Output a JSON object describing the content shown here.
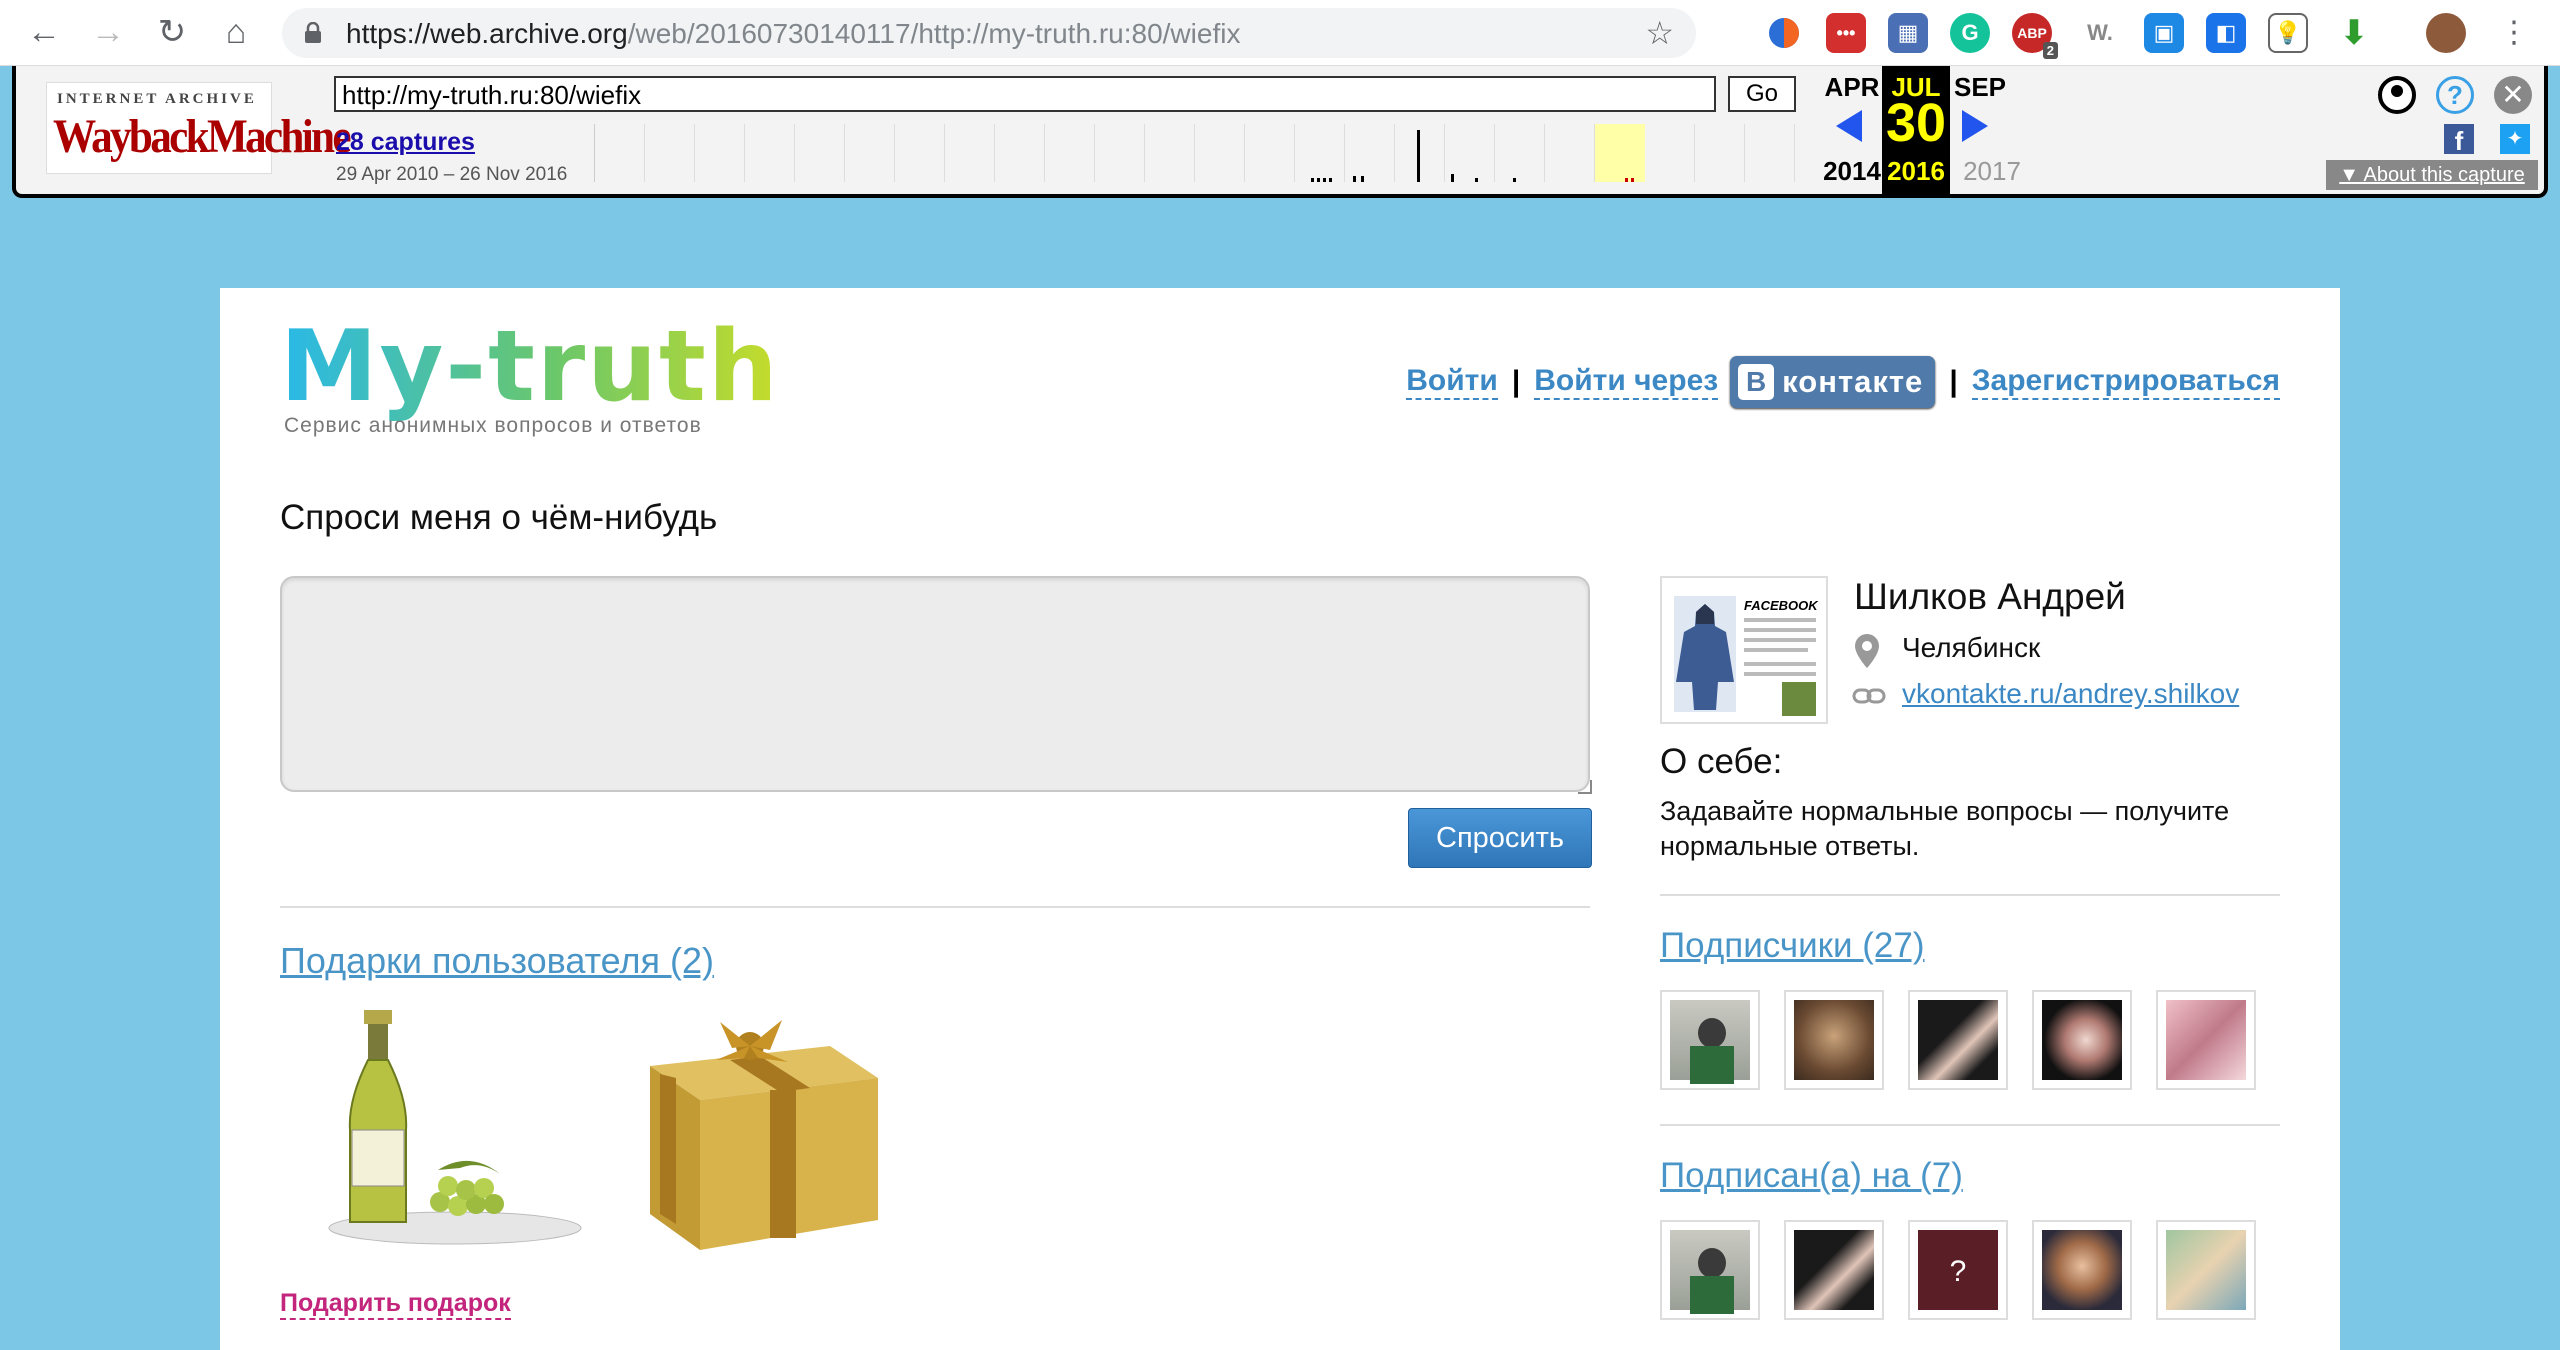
{
  "browser": {
    "url_host": "https://web.archive.org",
    "url_path": "/web/20160730140117/http://my-truth.ru:80/wiefix",
    "ext_badge_abp": "2",
    "ext_w": "W."
  },
  "wayback": {
    "logo_top": "INTERNET ARCHIVE",
    "logo_main": "WaybackMachine",
    "url_value": "http://my-truth.ru:80/wiefix",
    "go_label": "Go",
    "captures_label": "28 captures",
    "date_range": "29 Apr 2010 – 26 Nov 2016",
    "prev_month": "APR",
    "cur_month": "JUL",
    "next_month": "SEP",
    "cur_day": "30",
    "prev_year": "2014",
    "cur_year": "2016",
    "next_year": "2017",
    "about_label": "About this capture"
  },
  "site": {
    "logo": "My-truth",
    "tagline": "Сервис анонимных вопросов и ответов",
    "login": "Войти",
    "login_via": "Войти через",
    "vk_letter": "В",
    "vk_label": "контакте",
    "register": "Зарегистрироваться",
    "ask_heading": "Спроси меня о чём-нибудь",
    "ask_button": "Спросить",
    "gifts_heading": "Подарки пользователя (2)",
    "gift_link": "Подарить подарок"
  },
  "profile": {
    "name": "Шилков Андрей",
    "city": "Челябинск",
    "link": "vkontakte.ru/andrey.shilkov",
    "about_heading": "О себе:",
    "about_text": "Задавайте нормальные вопросы — получите нормальные ответы.",
    "avatar_caption": "FACEBOOK",
    "followers_heading": "Подписчики (27)",
    "following_heading": "Подписан(а) на (7)",
    "unknown_mark": "?"
  },
  "colors": {
    "page_bg": "#7cc6e6",
    "link": "#3b88c4",
    "gift_link": "#c3257c",
    "vk": "#4f7aa9"
  }
}
